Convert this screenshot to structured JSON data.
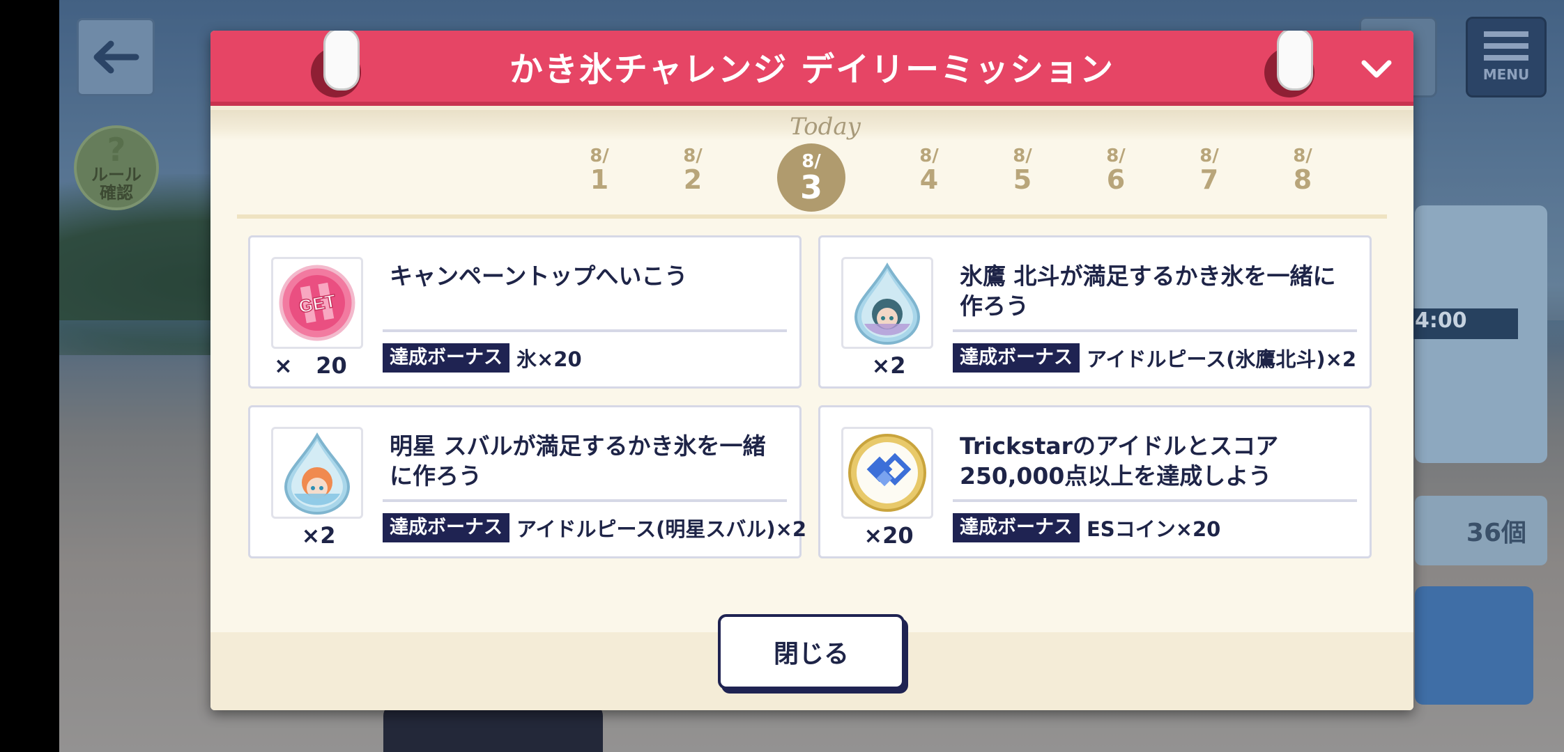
{
  "background": {
    "rule_badge": {
      "mark": "?",
      "line1": "ルール",
      "line2": "確認"
    },
    "menu_label": "MENU",
    "side_time": "4:00",
    "side_count": "36個"
  },
  "modal": {
    "title": "かき氷チャレンジ デイリーミッション",
    "today_label": "Today",
    "days": [
      {
        "month": "8/",
        "day": "1"
      },
      {
        "month": "8/",
        "day": "2"
      },
      {
        "month": "8/",
        "day": "3",
        "today": true
      },
      {
        "month": "8/",
        "day": "4"
      },
      {
        "month": "8/",
        "day": "5"
      },
      {
        "month": "8/",
        "day": "6"
      },
      {
        "month": "8/",
        "day": "7"
      },
      {
        "month": "8/",
        "day": "8"
      }
    ],
    "missions": [
      {
        "text": "キャンペーントップへいこう",
        "qty": "×   20",
        "bonus_tag": "達成ボーナス",
        "bonus": "氷×20",
        "item_icon": "get-ticket-icon"
      },
      {
        "text": "氷鷹 北斗が満足するかき氷を一緒に作ろう",
        "qty": "×2",
        "bonus_tag": "達成ボーナス",
        "bonus": "アイドルピース(氷鷹北斗)×2",
        "item_icon": "idol-piece-hokuto-icon"
      },
      {
        "text": "明星 スバルが満足するかき氷を一緒に作ろう",
        "qty": "×2",
        "bonus_tag": "達成ボーナス",
        "bonus": "アイドルピース(明星スバル)×2",
        "item_icon": "idol-piece-subaru-icon"
      },
      {
        "text": "Trickstarのアイドルとスコア250,000点以上を達成しよう",
        "qty": "×20",
        "bonus_tag": "達成ボーナス",
        "bonus": "ESコイン×20",
        "item_icon": "es-coin-icon"
      }
    ],
    "close_label": "閉じる"
  },
  "colors": {
    "header": "#e64565",
    "navy": "#1f2352",
    "gold": "#b09b6e",
    "paper": "#fbf7ea"
  }
}
